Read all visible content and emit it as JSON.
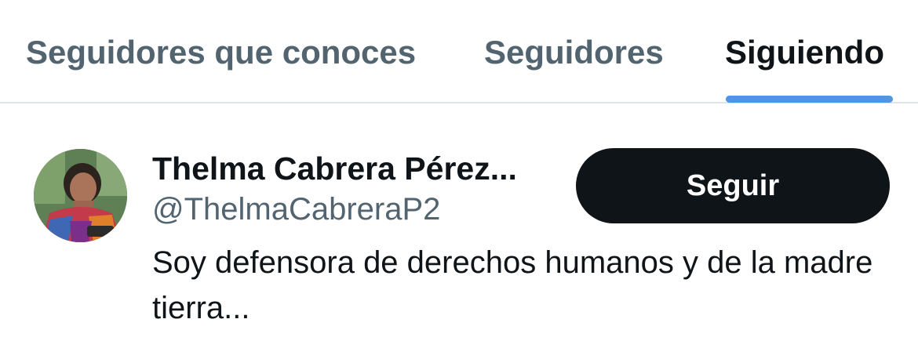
{
  "tabs": [
    {
      "label": "Seguidores que conoces",
      "active": false
    },
    {
      "label": "Seguidores",
      "active": false
    },
    {
      "label": "Siguiendo",
      "active": true
    }
  ],
  "colors": {
    "text_primary": "#0f1419",
    "text_secondary": "#536471",
    "accent": "#4c96e3",
    "button_bg": "#0f1419",
    "divider": "#e1e5e8"
  },
  "user": {
    "display_name": "Thelma Cabrera Pérez...",
    "handle": "@ThelmaCabreraP2",
    "follow_label": "Seguir",
    "bio": "Soy defensora de derechos humanos y de la madre tierra...",
    "avatar_icon": "avatar-photo"
  }
}
